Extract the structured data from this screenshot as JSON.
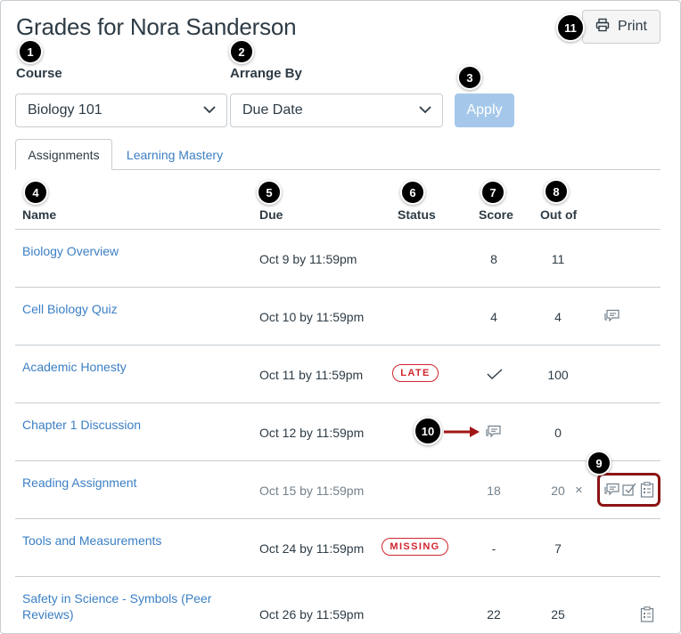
{
  "page": {
    "title": "Grades for Nora Sanderson",
    "print_label": "Print"
  },
  "filters": {
    "course_label": "Course",
    "course_value": "Biology 101",
    "arrange_label": "Arrange By",
    "arrange_value": "Due Date",
    "apply_label": "Apply"
  },
  "tabs": [
    {
      "label": "Assignments",
      "active": true
    },
    {
      "label": "Learning Mastery",
      "active": false
    }
  ],
  "columns": {
    "name": "Name",
    "due": "Due",
    "status": "Status",
    "score": "Score",
    "out_of": "Out of"
  },
  "rows": [
    {
      "name": "Biology Overview",
      "due": "Oct 9 by 11:59pm",
      "status": "",
      "score": "8",
      "out_of": "11"
    },
    {
      "name": "Cell Biology Quiz",
      "due": "Oct 10 by 11:59pm",
      "status": "",
      "score": "4",
      "out_of": "4"
    },
    {
      "name": "Academic Honesty",
      "due": "Oct 11 by 11:59pm",
      "status": "LATE",
      "score": "",
      "out_of": "100"
    },
    {
      "name": "Chapter 1 Discussion",
      "due": "Oct 12 by 11:59pm",
      "status": "",
      "score": "",
      "out_of": "0"
    },
    {
      "name": "Reading Assignment",
      "due": "Oct 15 by 11:59pm",
      "status": "",
      "score": "18",
      "out_of": "20",
      "close": "×"
    },
    {
      "name": "Tools and Measurements",
      "due": "Oct 24 by 11:59pm",
      "status": "MISSING",
      "score": "-",
      "out_of": "7"
    },
    {
      "name": "Safety in Science - Symbols (Peer Reviews)",
      "due": "Oct 26 by 11:59pm",
      "status": "",
      "score": "22",
      "out_of": "25"
    }
  ],
  "callouts": [
    "1",
    "2",
    "3",
    "4",
    "5",
    "6",
    "7",
    "8",
    "9",
    "10",
    "11"
  ],
  "icons": {
    "print": "printer-icon",
    "comment": "comment-icon",
    "check": "checkmark-icon",
    "rubric": "rubric-icon",
    "peer_review": "peer-review-icon"
  },
  "colors": {
    "link": "#3b7fc4",
    "alert": "#d0262f",
    "apply_disabled": "#a5c8ea",
    "callout": "#000000",
    "highlight": "#8b1414"
  }
}
